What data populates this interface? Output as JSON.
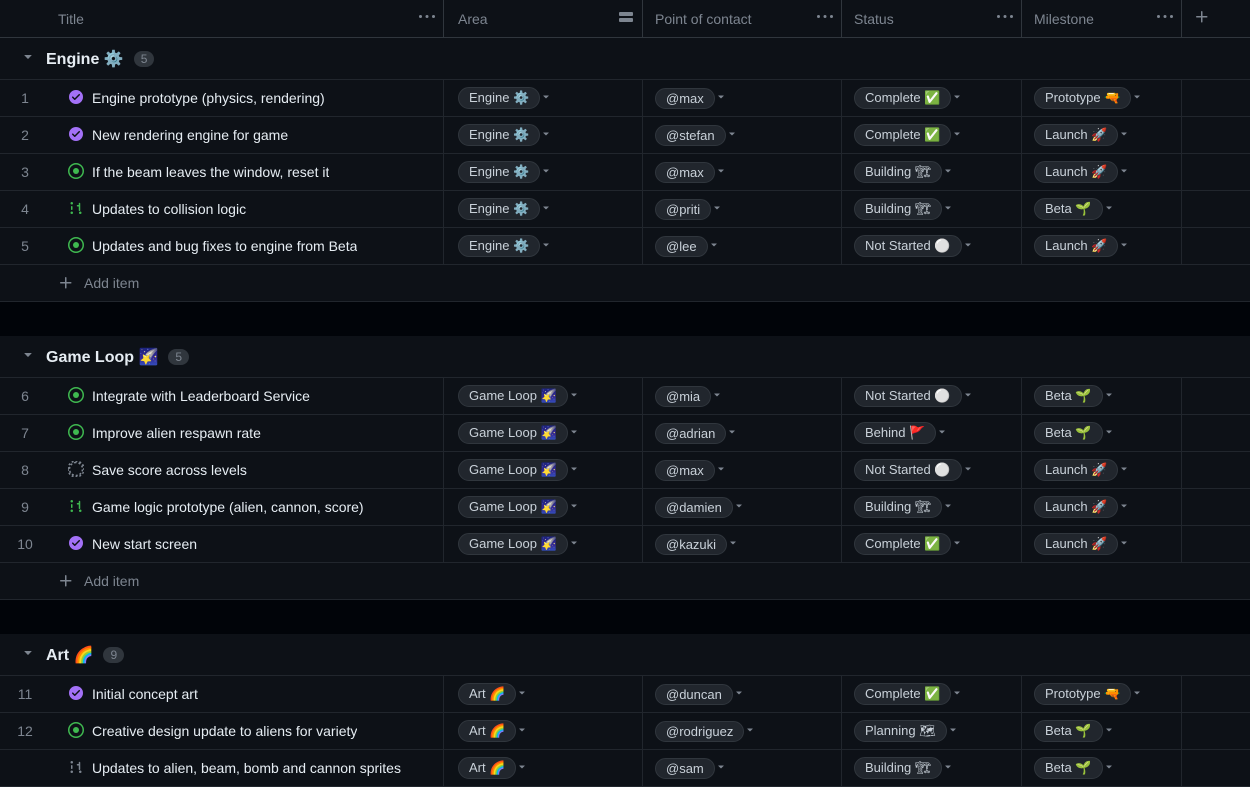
{
  "columns": {
    "title": "Title",
    "area": "Area",
    "contact": "Point of contact",
    "status": "Status",
    "milestone": "Milestone"
  },
  "add_item_label": "Add item",
  "groups": [
    {
      "name": "Engine ⚙️",
      "count": "5",
      "rows": [
        {
          "num": "1",
          "icon": "closed",
          "title": "Engine prototype (physics, rendering)",
          "area": "Engine ⚙️",
          "contact": "@max",
          "status": "Complete ✅",
          "milestone": "Prototype 🔫"
        },
        {
          "num": "2",
          "icon": "closed",
          "title": "New rendering engine for game",
          "area": "Engine ⚙️",
          "contact": "@stefan",
          "status": "Complete ✅",
          "milestone": "Launch 🚀"
        },
        {
          "num": "3",
          "icon": "open",
          "title": "If the beam leaves the window, reset it",
          "area": "Engine ⚙️",
          "contact": "@max",
          "status": "Building 🏗",
          "milestone": "Launch 🚀"
        },
        {
          "num": "4",
          "icon": "pr",
          "title": "Updates to collision logic",
          "area": "Engine ⚙️",
          "contact": "@priti",
          "status": "Building 🏗",
          "milestone": "Beta 🌱"
        },
        {
          "num": "5",
          "icon": "open",
          "title": "Updates and bug fixes to engine from Beta",
          "area": "Engine ⚙️",
          "contact": "@lee",
          "status": "Not Started ⚪",
          "milestone": "Launch 🚀"
        }
      ]
    },
    {
      "name": "Game Loop 🌠",
      "count": "5",
      "rows": [
        {
          "num": "6",
          "icon": "open",
          "title": "Integrate with Leaderboard Service",
          "area": "Game Loop 🌠",
          "contact": "@mia",
          "status": "Not Started ⚪",
          "milestone": "Beta 🌱"
        },
        {
          "num": "7",
          "icon": "open",
          "title": "Improve alien respawn rate",
          "area": "Game Loop 🌠",
          "contact": "@adrian",
          "status": "Behind 🚩",
          "milestone": "Beta 🌱"
        },
        {
          "num": "8",
          "icon": "draft",
          "title": "Save score across levels",
          "area": "Game Loop 🌠",
          "contact": "@max",
          "status": "Not Started ⚪",
          "milestone": "Launch 🚀"
        },
        {
          "num": "9",
          "icon": "pr",
          "title": "Game logic prototype (alien, cannon, score)",
          "area": "Game Loop 🌠",
          "contact": "@damien",
          "status": "Building 🏗",
          "milestone": "Launch 🚀"
        },
        {
          "num": "10",
          "icon": "closed",
          "title": "New start screen",
          "area": "Game Loop 🌠",
          "contact": "@kazuki",
          "status": "Complete ✅",
          "milestone": "Launch 🚀"
        }
      ]
    },
    {
      "name": "Art 🌈",
      "count": "9",
      "rows": [
        {
          "num": "11",
          "icon": "closed",
          "title": "Initial concept art",
          "area": "Art 🌈",
          "contact": "@duncan",
          "status": "Complete ✅",
          "milestone": "Prototype 🔫"
        },
        {
          "num": "12",
          "icon": "open",
          "title": "Creative design update to aliens for variety",
          "area": "Art 🌈",
          "contact": "@rodriguez",
          "status": "Planning 🗺",
          "milestone": "Beta 🌱"
        },
        {
          "num": "",
          "icon": "pr-draft",
          "title": "Updates to alien, beam, bomb and cannon sprites",
          "area": "Art 🌈",
          "contact": "@sam",
          "status": "Building 🏗",
          "milestone": "Beta 🌱"
        }
      ]
    }
  ]
}
